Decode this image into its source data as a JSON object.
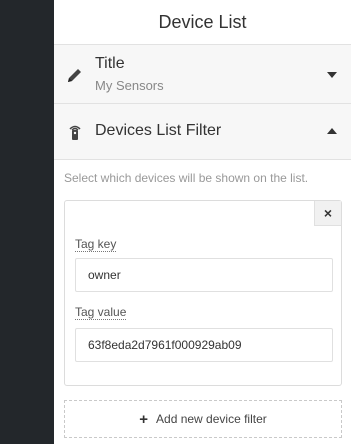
{
  "panel": {
    "header_title": "Device List"
  },
  "title_section": {
    "label": "Title",
    "value": "My Sensors",
    "icon": "pencil-icon",
    "state": "collapsed"
  },
  "filter_section": {
    "label": "Devices List Filter",
    "icon": "sensor-icon",
    "state": "expanded",
    "help_text": "Select which devices will be shown on the list.",
    "filter": {
      "close_symbol": "×",
      "tag_key_label": "Tag key",
      "tag_key_value": "owner",
      "tag_value_label": "Tag value",
      "tag_value_value": "63f8eda2d7961f000929ab09"
    },
    "add_button": {
      "plus_symbol": "+",
      "label": "Add new device filter"
    }
  },
  "colors": {
    "sidebar_dark": "#23272b",
    "section_bg": "#f7f7f7"
  }
}
